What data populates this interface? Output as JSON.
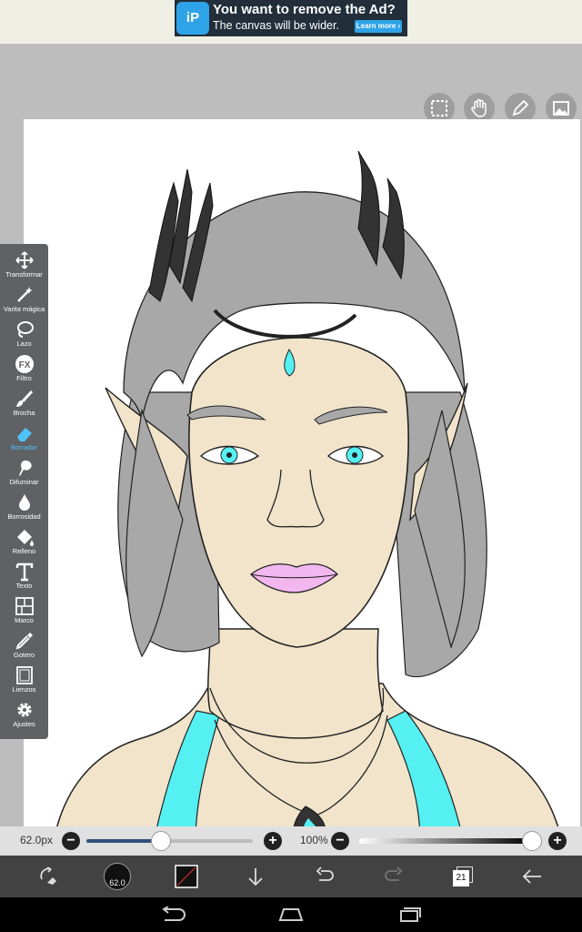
{
  "ad": {
    "logo": "iP",
    "title": "You want to remove the Ad?",
    "subtitle": "The canvas will be wider.",
    "button": "Learn more ›"
  },
  "tools": [
    {
      "label": "Transformar",
      "icon": "move-icon"
    },
    {
      "label": "Varita mágica",
      "icon": "magic-wand-icon"
    },
    {
      "label": "Lazo",
      "icon": "lasso-icon"
    },
    {
      "label": "Filtro",
      "icon": "fx-icon"
    },
    {
      "label": "Brocha",
      "icon": "brush-icon"
    },
    {
      "label": "Borrador",
      "icon": "eraser-icon",
      "active": true
    },
    {
      "label": "Difuminar",
      "icon": "smudge-icon"
    },
    {
      "label": "Borrosidad",
      "icon": "blur-drop-icon"
    },
    {
      "label": "Relleno",
      "icon": "fill-bucket-icon"
    },
    {
      "label": "Texto",
      "icon": "text-icon"
    },
    {
      "label": "Marco",
      "icon": "frame-divider-icon"
    },
    {
      "label": "Gotero",
      "icon": "eyedropper-icon"
    },
    {
      "label": "Lienzos",
      "icon": "canvas-icon"
    },
    {
      "label": "Ajustes",
      "icon": "gear-icon"
    }
  ],
  "top_tools": [
    "selection-icon",
    "hand-icon",
    "pen-icon",
    "image-icon"
  ],
  "brush": {
    "size_label": "62.0px",
    "size_value": 62.0,
    "size_fraction": 0.45,
    "indicator_label": "62.0"
  },
  "opacity": {
    "label": "100%",
    "fraction": 1.0
  },
  "layers": {
    "count": "21"
  },
  "colors": {
    "accent": "#4fc3f7",
    "toolbar": "#5f6165",
    "bottom_bar": "#424242"
  }
}
